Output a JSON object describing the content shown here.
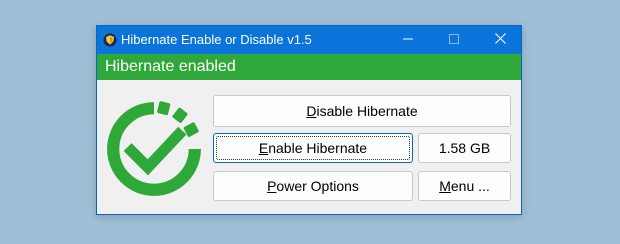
{
  "window": {
    "title": "Hibernate Enable or Disable v1.5",
    "app_icon": "shield-app-icon"
  },
  "titlebar_controls": {
    "minimize_icon": "minimize-icon",
    "maximize_icon": "maximize-icon",
    "close_icon": "close-icon"
  },
  "status": {
    "text": "Hibernate enabled",
    "color": "#2fa83a"
  },
  "indicator": {
    "icon": "checkmark-circle-icon",
    "color": "#2fa83a"
  },
  "buttons": {
    "disable": {
      "mnemonic": "D",
      "rest": "isable Hibernate"
    },
    "enable": {
      "mnemonic": "E",
      "rest": "nable Hibernate"
    },
    "power": {
      "mnemonic": "P",
      "rest": "ower Options"
    },
    "menu": {
      "mnemonic": "M",
      "rest": "enu ..."
    }
  },
  "hiberfile_size": "1.58 GB",
  "colors": {
    "titlebar": "#0a74da",
    "accent_border": "#0a66c6",
    "background": "#9fbfd6"
  }
}
